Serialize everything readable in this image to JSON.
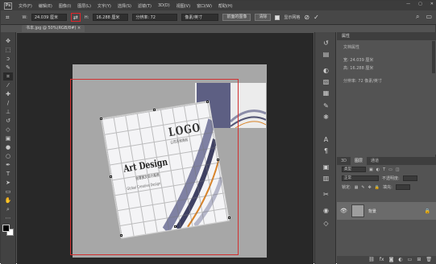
{
  "menubar": {
    "app_icon": "Ps",
    "items": [
      "文件(F)",
      "编辑(E)",
      "图像(I)",
      "图层(L)",
      "文字(Y)",
      "选择(S)",
      "滤镜(T)",
      "3D(D)",
      "视图(V)",
      "窗口(W)",
      "帮助(H)"
    ],
    "window_controls": [
      "—",
      "▢",
      "✕"
    ]
  },
  "options": {
    "w_label": "W:",
    "w_value": "24.039 厘米",
    "h_label": "H:",
    "h_value": "16.288 厘米",
    "resolution_value": "分辨率: 72",
    "unit_value": "像素/英寸",
    "front_image_button": "前面的图像",
    "clear_button": "清除",
    "show_grid_label": "显示网格",
    "search_icon": "search-icon",
    "workspace_icon": "workspace-icon"
  },
  "document": {
    "tab_label": "书本.jpg @ 50%(RGB/8#) ×",
    "cover_logo": "LOGO",
    "cover_logo_sub": "公司名称商标",
    "cover_title": "Art Design",
    "cover_title_sub": "创意图文设计画册",
    "cover_tagline": "Global Creative Design"
  },
  "tools": [
    "move",
    "marquee",
    "lasso",
    "quick-select",
    "crop",
    "eyedropper",
    "heal",
    "brush",
    "stamp",
    "history-brush",
    "eraser",
    "gradient",
    "blur",
    "dodge",
    "pen",
    "type",
    "path-select",
    "shape",
    "hand",
    "zoom"
  ],
  "right_icons": [
    "history",
    "properties",
    "adjust",
    "styles",
    "swatches",
    "brush-settings",
    "paragraph",
    "character",
    "libraries",
    "layers",
    "channels",
    "paths"
  ],
  "properties": {
    "title": "属性",
    "doc_label": "文档属性",
    "w_row": "宽: 24.039 厘米",
    "h_row": "高: 16.288 厘米",
    "res_row": "分辨率: 72 像素/英寸"
  },
  "layers": {
    "tabs": [
      "3D",
      "图层",
      "通道"
    ],
    "kind_label": "类型",
    "blend_mode": "正常",
    "opacity_label": "不透明度:",
    "lock_label": "锁定:",
    "fill_label": "填充:",
    "layer_name": "背景"
  },
  "colors": {
    "accent": "#d23030",
    "cover_panel": "#5d5f83",
    "wave_orange": "#d9842a"
  }
}
